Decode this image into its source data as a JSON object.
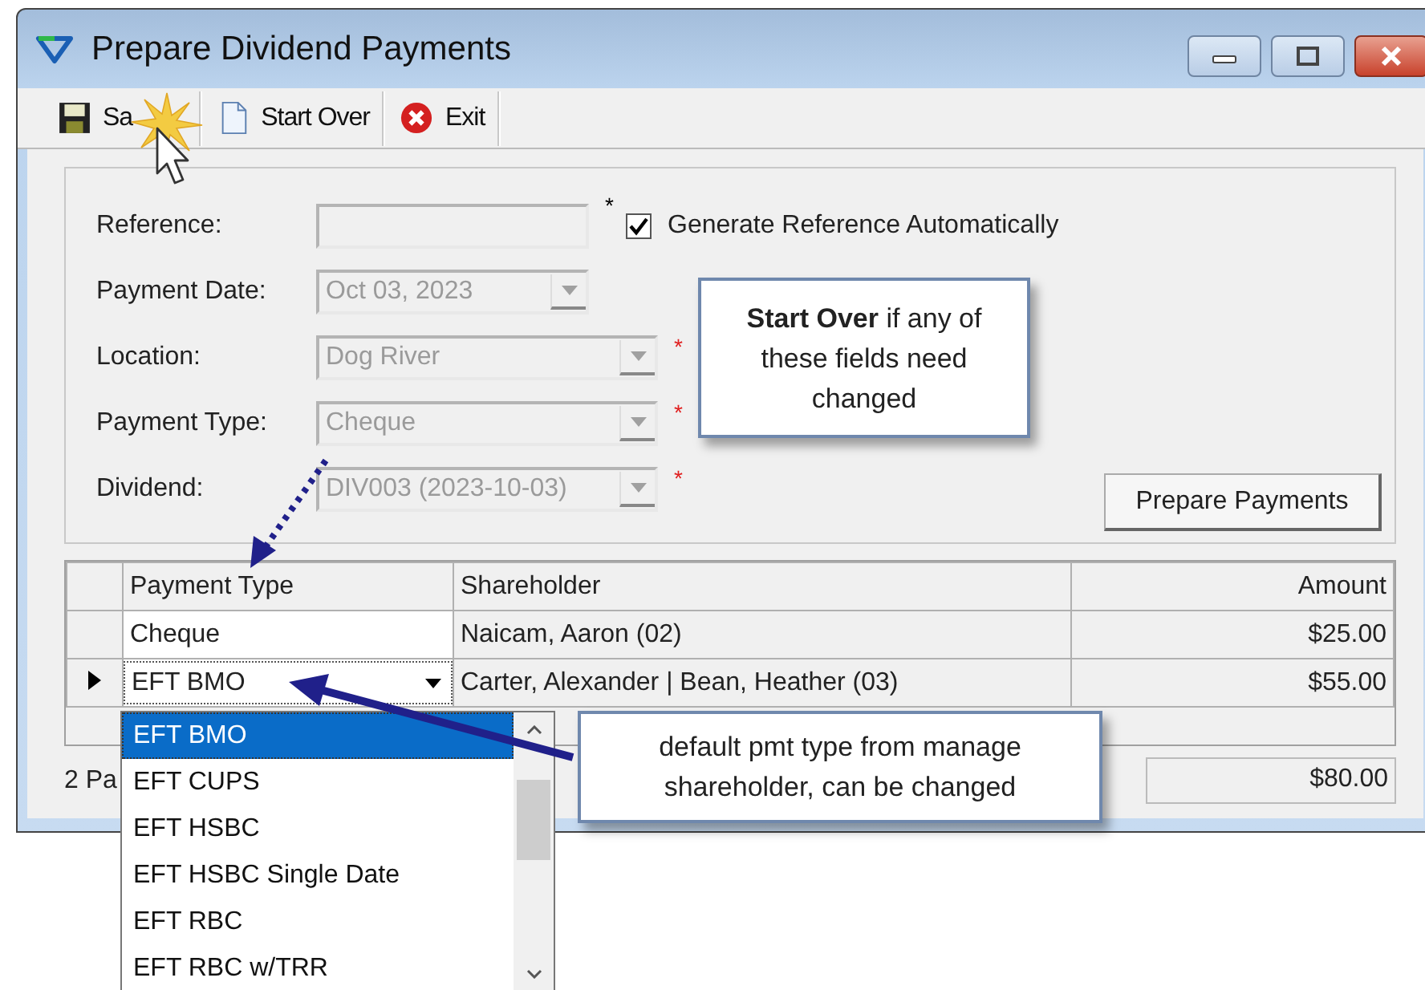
{
  "window": {
    "title": "Prepare Dividend Payments"
  },
  "toolbar": [
    {
      "kind": "save",
      "label": "Sa"
    },
    {
      "kind": "new",
      "label": "Start Over"
    },
    {
      "kind": "exit",
      "label": "Exit"
    }
  ],
  "form": {
    "fields": [
      {
        "kind": "text",
        "label": "Reference:",
        "disabled": true,
        "marker": {
          "text": "*",
          "color": "#000000"
        }
      },
      {
        "kind": "date",
        "label": "Payment Date:",
        "value": "Oct  03, 2023",
        "disabled": true
      },
      {
        "kind": "combo",
        "label": "Location:",
        "value": "Dog River",
        "disabled": true,
        "marker": {
          "text": "*",
          "color": "#e02020"
        }
      },
      {
        "kind": "combo",
        "label": "Payment Type:",
        "value": "Cheque",
        "disabled": true,
        "marker": {
          "text": "*",
          "color": "#e02020"
        }
      },
      {
        "kind": "combo",
        "label": "Dividend:",
        "value": "DIV003 (2023-10-03)",
        "disabled": true,
        "marker": {
          "text": "*",
          "color": "#e02020"
        }
      }
    ],
    "checkbox": {
      "label": "Generate Reference Automatically",
      "checked": true
    },
    "button": "Prepare Payments"
  },
  "grid": {
    "columns": [
      "Payment Type",
      "Shareholder",
      "Amount"
    ],
    "rows": [
      {
        "cells": [
          "Cheque",
          "Naicam, Aaron (02)",
          "$25.00"
        ],
        "current": false,
        "editing": false
      },
      {
        "cells": [
          "EFT BMO",
          "Carter, Alexander | Bean, Heather (03)",
          "$55.00"
        ],
        "current": true,
        "editing": true
      }
    ]
  },
  "status": "2 Pa",
  "total": "$80.00",
  "dropdown": {
    "items": [
      {
        "label": "EFT BMO",
        "selected": true
      },
      {
        "label": "EFT CUPS",
        "selected": false
      },
      {
        "label": "EFT HSBC",
        "selected": false
      },
      {
        "label": "EFT HSBC Single Date",
        "selected": false
      },
      {
        "label": "EFT RBC",
        "selected": false
      },
      {
        "label": "EFT RBC w/TRR",
        "selected": false
      }
    ]
  },
  "callouts": [
    {
      "text": "**Start Over** if any of these fields need changed"
    },
    {
      "text": "default pmt type from manage shareholder, can be changed"
    }
  ]
}
